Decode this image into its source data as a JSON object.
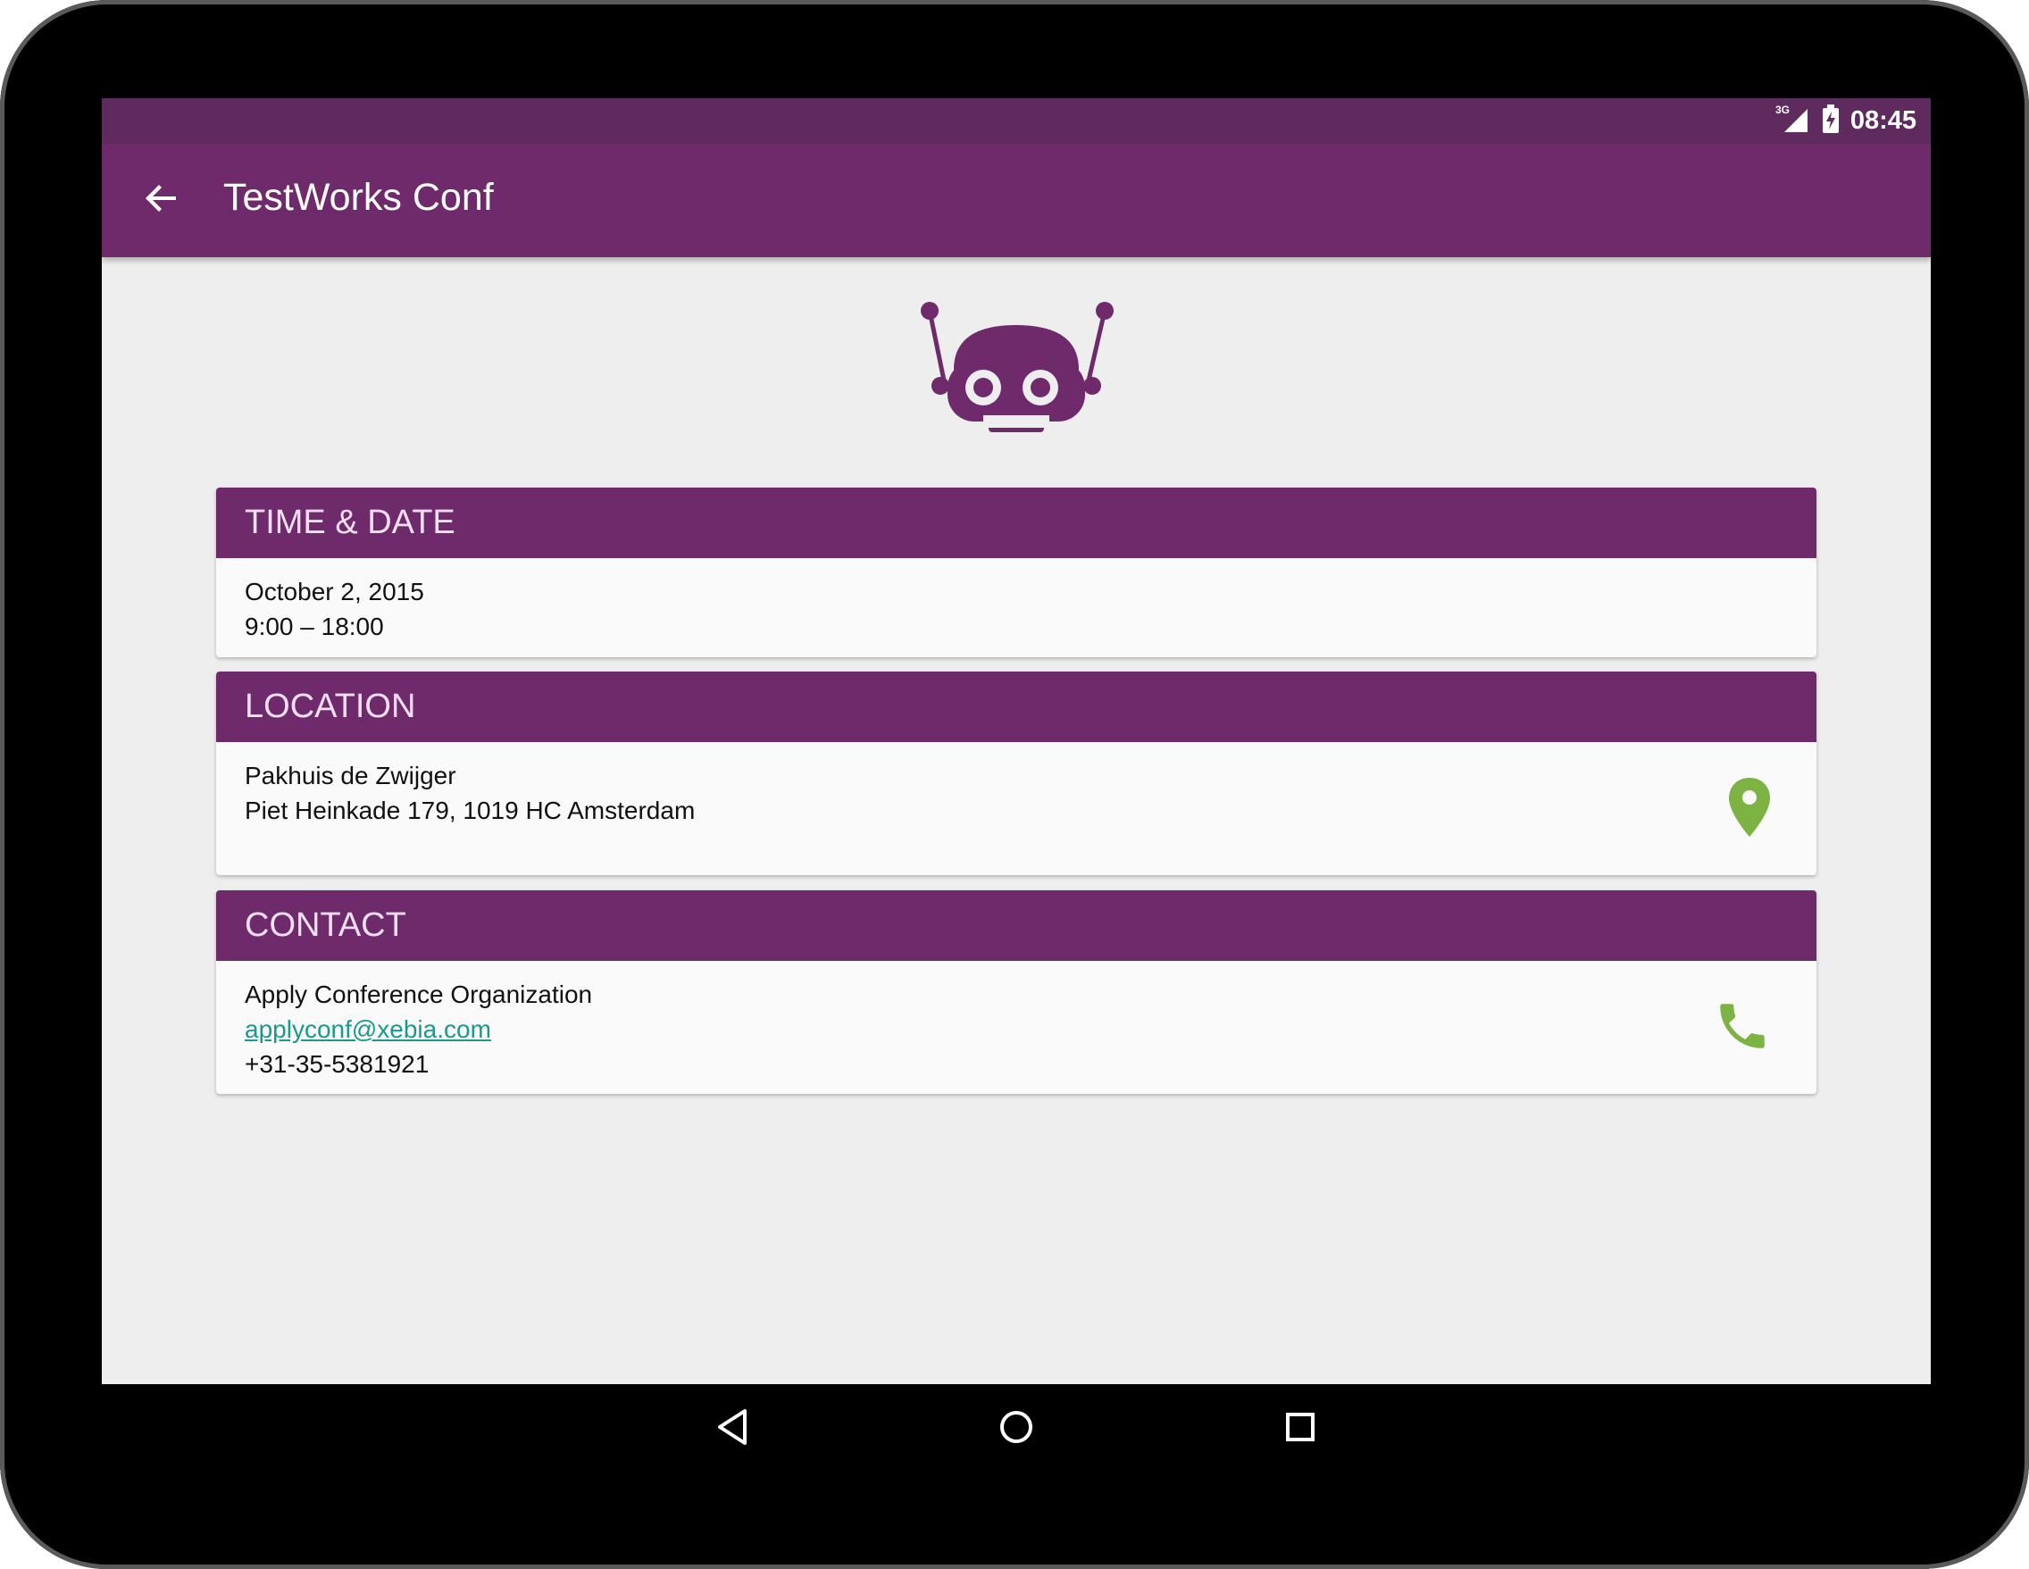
{
  "status_bar": {
    "network": "3G",
    "time": "08:45"
  },
  "app_bar": {
    "title": "TestWorks Conf"
  },
  "sections": {
    "time_date": {
      "header": "TIME & DATE",
      "date": "October 2, 2015",
      "time": "9:00 – 18:00"
    },
    "location": {
      "header": "LOCATION",
      "venue": "Pakhuis de Zwijger",
      "address": "Piet Heinkade 179, 1019 HC Amsterdam",
      "icon": "map-pin-icon"
    },
    "contact": {
      "header": "CONTACT",
      "organization": "Apply Conference Organization",
      "email": "applyconf@xebia.com",
      "phone": "+31-35-5381921",
      "icon": "phone-icon"
    }
  },
  "colors": {
    "primary": "#6e2a6b",
    "primary_dark": "#5f2a5e",
    "accent": "#7cb342",
    "link": "#1a9a8a",
    "background": "#eeeeee"
  }
}
